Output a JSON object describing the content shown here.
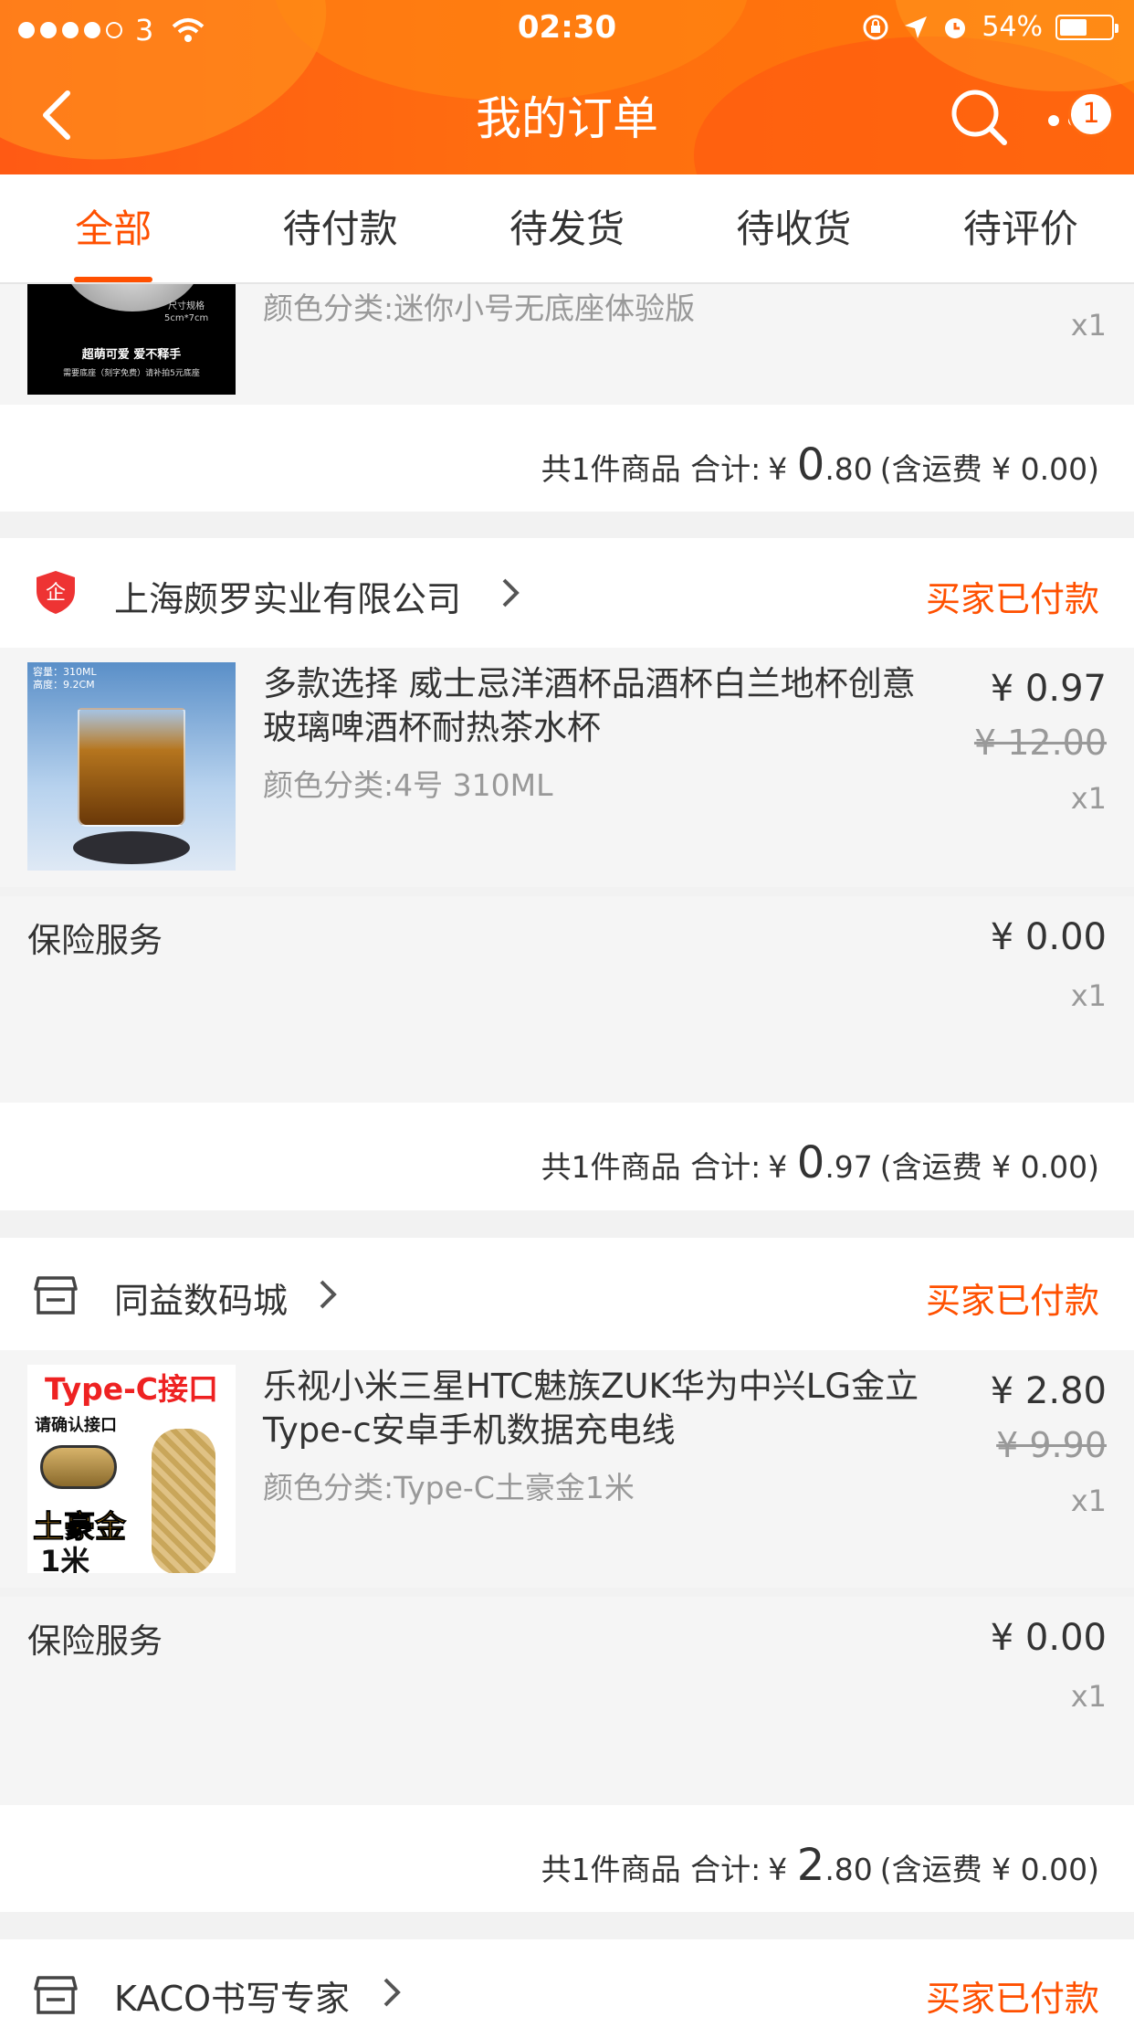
{
  "status_bar": {
    "carrier": "3",
    "time": "02:30",
    "battery": "54%"
  },
  "nav": {
    "title": "我的订单",
    "badge": "1"
  },
  "tabs": [
    "全部",
    "待付款",
    "待发货",
    "待收货",
    "待评价"
  ],
  "colors": {
    "accent": "#ff5000",
    "header": "#ff6a10"
  },
  "order0": {
    "spec": "颜色分类:迷你小号无底座体验版",
    "qty": "x1",
    "thumb_text_1": "尺寸规格",
    "thumb_text_2": "5cm*7cm",
    "thumb_text_3": "超萌可爱 爱不释手",
    "thumb_text_4": "需要底座（刻字免费）请补拍5元底座",
    "summary": {
      "count": "共1件商品 合计:",
      "currency": "¥",
      "int": "0",
      "dec": ".80",
      "shipping": "(含运费 ¥ 0.00)"
    }
  },
  "order1": {
    "shop": "上海颇罗实业有限公司",
    "status": "买家已付款",
    "shop_icon": "enterprise-shield-icon",
    "item": {
      "title": "多款选择 威士忌洋酒杯品酒杯白兰地杯创意玻璃啤酒杯耐热茶水杯",
      "spec": "颜色分类:4号 310ML",
      "price": "¥ 0.97",
      "original_price": "¥ 12.00",
      "qty": "x1",
      "thumb_text_1": "容量：310ML",
      "thumb_text_2": "高度：9.2CM"
    },
    "service": {
      "label": "保险服务",
      "price": "¥ 0.00",
      "qty": "x1"
    },
    "summary": {
      "count": "共1件商品 合计:",
      "currency": "¥",
      "int": "0",
      "dec": ".97",
      "shipping": "(含运费 ¥ 0.00)"
    }
  },
  "order2": {
    "shop": "同益数码城",
    "status": "买家已付款",
    "shop_icon": "store-icon",
    "item": {
      "title": "乐视小米三星HTC魅族ZUK华为中兴LG金立Type-c安卓手机数据充电线",
      "spec": "颜色分类:Type-C土豪金1米",
      "price": "¥ 2.80",
      "original_price": "¥ 9.90",
      "qty": "x1",
      "thumb_text_1": "Type-C接口",
      "thumb_text_2": "请确认接口",
      "thumb_text_3": "土豪金",
      "thumb_text_4": "1米"
    },
    "service": {
      "label": "保险服务",
      "price": "¥ 0.00",
      "qty": "x1"
    },
    "summary": {
      "count": "共1件商品 合计:",
      "currency": "¥",
      "int": "2",
      "dec": ".80",
      "shipping": "(含运费 ¥ 0.00)"
    }
  },
  "order3": {
    "shop": "KACO书写专家",
    "status": "买家已付款",
    "shop_icon": "store-icon"
  }
}
